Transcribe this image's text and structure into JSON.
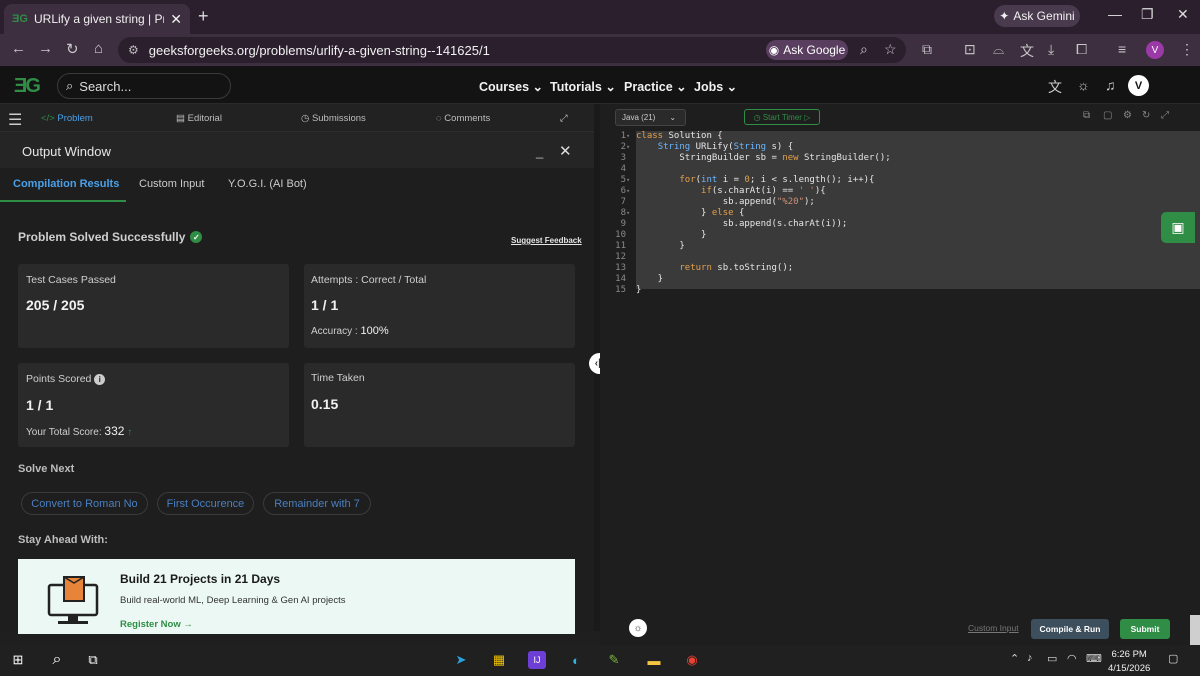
{
  "browser": {
    "tab_title": "URLify a given string | Practice |",
    "tab_favicon": "GfG",
    "new_tab": "+",
    "ask_gemini": "Ask Gemini",
    "url": "geeksforgeeks.org/problems/urlify-a-given-string--141625/1",
    "ask_google": "Ask Google",
    "profile_initial": "V"
  },
  "site": {
    "logo": "GfG",
    "search_placeholder": "Search...",
    "nav": [
      "Courses",
      "Tutorials",
      "Practice",
      "Jobs"
    ],
    "user_initial": "V"
  },
  "left_tabs": [
    "Problem",
    "Editorial",
    "Submissions",
    "Comments"
  ],
  "output": {
    "title": "Output Window",
    "subtabs": [
      "Compilation Results",
      "Custom Input",
      "Y.O.G.I. (AI Bot)"
    ],
    "status": "Problem Solved Successfully",
    "suggest_feedback": "Suggest Feedback",
    "test_cases_label": "Test Cases Passed",
    "test_cases_value": "205 / 205",
    "attempts_label": "Attempts : Correct / Total",
    "attempts_value": "1 / 1",
    "accuracy_label": "Accuracy :",
    "accuracy_value": "100%",
    "points_label": "Points Scored",
    "points_value": "1 / 1",
    "total_score_label": "Your Total Score:",
    "total_score_value": "332",
    "time_label": "Time Taken",
    "time_value": "0.15",
    "solve_next_label": "Solve Next",
    "solve_next": [
      "Convert to Roman No",
      "First Occurence",
      "Remainder with 7"
    ],
    "stay_ahead_label": "Stay Ahead With:",
    "banner_title": "Build 21 Projects in 21 Days",
    "banner_sub": "Build real-world ML, Deep Learning & Gen AI projects",
    "banner_link": "Register Now →"
  },
  "editor": {
    "language": "Java (21)",
    "start_timer": "Start Timer",
    "custom_input": "Custom Input",
    "compile_run": "Compile & Run",
    "submit": "Submit",
    "lines": [
      "class Solution {",
      "    String URLify(String s) {",
      "        StringBuilder sb = new StringBuilder();",
      "",
      "        for(int i = 0; i < s.length(); i++){",
      "            if(s.charAt(i) == ' '){",
      "                sb.append(\"%20\");",
      "            } else {",
      "                sb.append(s.charAt(i));",
      "            }",
      "        }",
      "",
      "        return sb.toString();",
      "    }",
      "}"
    ]
  },
  "taskbar": {
    "time": "6:26 PM",
    "date": "4/15/2026"
  },
  "colors": {
    "gfg_green": "#2f8d46",
    "link_blue": "#4aa0e8"
  }
}
